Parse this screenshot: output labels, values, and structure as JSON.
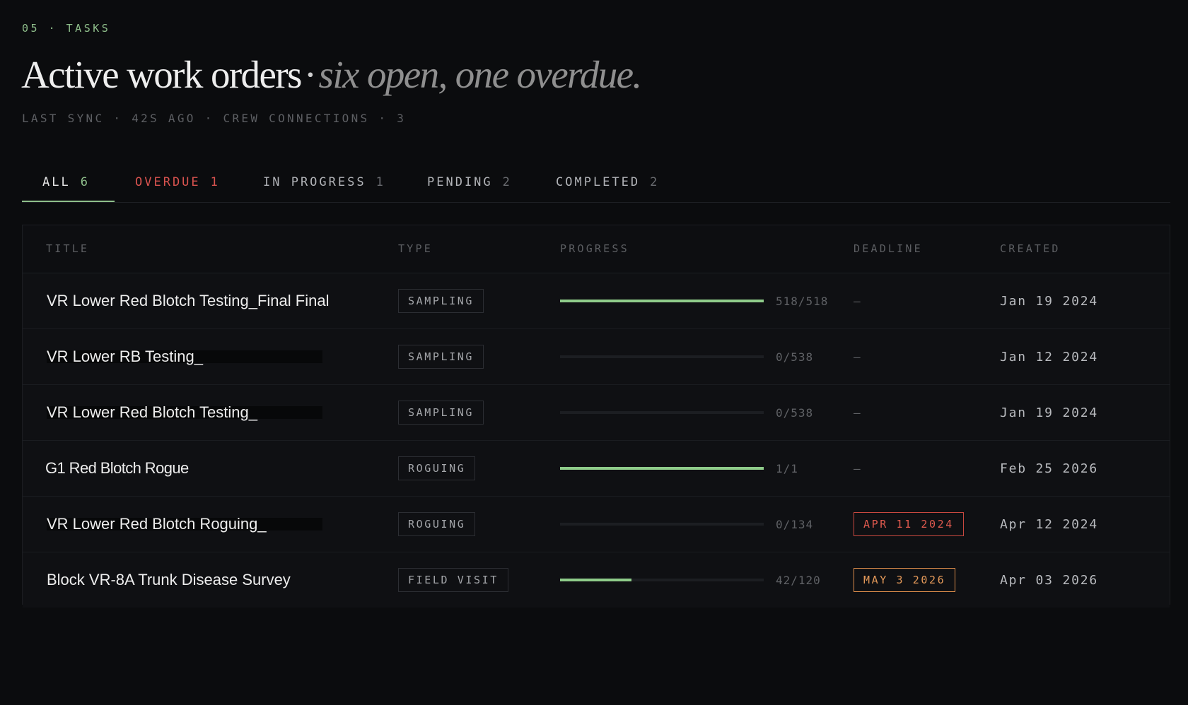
{
  "header": {
    "eyebrow": "05 · TASKS",
    "title_main": "Active work orders",
    "title_sep": "·",
    "title_emphasis": "six open, one overdue.",
    "subline": "LAST SYNC · 42S AGO · CREW CONNECTIONS · 3"
  },
  "tabs": [
    {
      "label": "ALL",
      "count": "6",
      "active": true
    },
    {
      "label": "OVERDUE",
      "count": "1"
    },
    {
      "label": "IN PROGRESS",
      "count": "1"
    },
    {
      "label": "PENDING",
      "count": "2"
    },
    {
      "label": "COMPLETED",
      "count": "2"
    }
  ],
  "table": {
    "columns": {
      "title": "TITLE",
      "type": "TYPE",
      "progress": "PROGRESS",
      "deadline": "DEADLINE",
      "created": "CREATED"
    },
    "rows": [
      {
        "title": "VR Lower Red Blotch Testing_Final Final",
        "type": "SAMPLING",
        "progress": "518/518",
        "progress_fraction": 1.0,
        "deadline": "—",
        "created": "Jan 19 2024"
      },
      {
        "title": "VR Lower RB Testing_",
        "type": "SAMPLING",
        "progress": "0/538",
        "progress_fraction": 0.0,
        "deadline": "—",
        "created": "Jan 12 2024"
      },
      {
        "title": "VR Lower Red Blotch Testing_",
        "type": "SAMPLING",
        "progress": "0/538",
        "progress_fraction": 0.0,
        "deadline": "—",
        "created": "Jan 19 2024"
      },
      {
        "title": "G1 Red Blotch Rogue",
        "type": "ROGUING",
        "progress": "1/1",
        "progress_fraction": 1.0,
        "deadline": "—",
        "created": "Feb 25 2026"
      },
      {
        "title": "VR Lower Red Blotch Roguing_",
        "type": "ROGUING",
        "progress": "0/134",
        "progress_fraction": 0.0,
        "deadline": "APR 11 2024",
        "deadline_status": "overdue",
        "created": "Apr 12 2024"
      },
      {
        "title": "Block VR-8A Trunk Disease Survey",
        "type": "FIELD VISIT",
        "progress": "42/120",
        "progress_fraction": 0.35,
        "deadline": "MAY 3 2026",
        "deadline_status": "upcoming",
        "created": "Apr 03 2026"
      }
    ]
  },
  "colors": {
    "accent": "#8fbf8b",
    "overdue": "#d9534f",
    "upcoming": "#e59a5a",
    "background": "#0b0c0e"
  }
}
